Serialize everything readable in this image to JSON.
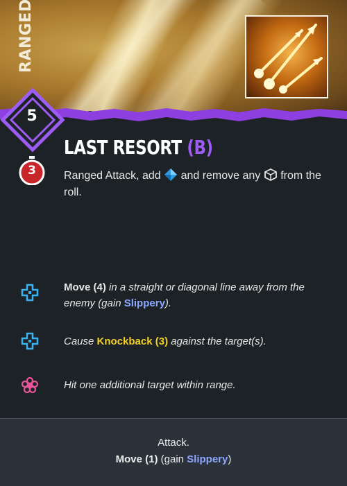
{
  "card": {
    "category": "RANGED",
    "cost": "5",
    "timer": "3",
    "title": "LAST RESORT",
    "title_tag": "(B)",
    "main": {
      "part1": "Ranged Attack, add",
      "part2": "and remove any",
      "part3": "from the roll."
    },
    "augments": [
      {
        "icon": "blue-cross-icon",
        "bold": "Move (4)",
        "text1": " in a straight or diagonal line away from the enemy (gain ",
        "keyword": "Slippery",
        "text2": ")."
      },
      {
        "icon": "blue-cross-icon",
        "text1": "Cause ",
        "keyword": "Knockback (3)",
        "text2": " against the target(s)."
      },
      {
        "icon": "pink-flower-icon",
        "text1": "Hit one additional target within range."
      }
    ],
    "footer": {
      "line1": "Attack.",
      "bold": "Move (1)",
      "text1": " (gain ",
      "keyword": "Slippery",
      "text2": ")"
    }
  },
  "colors": {
    "accent_purple": "#9d5cf3",
    "timer_red": "#c8262a",
    "keyword_blue": "#8ca6ff",
    "keyword_yellow": "#f3d02a",
    "augment_blue": "#3ab4f0",
    "augment_pink": "#e8559a"
  },
  "icons": {
    "artwork": "triple-arrows-icon",
    "attack_die": "blue-die-icon",
    "plain_die": "outline-die-icon"
  }
}
